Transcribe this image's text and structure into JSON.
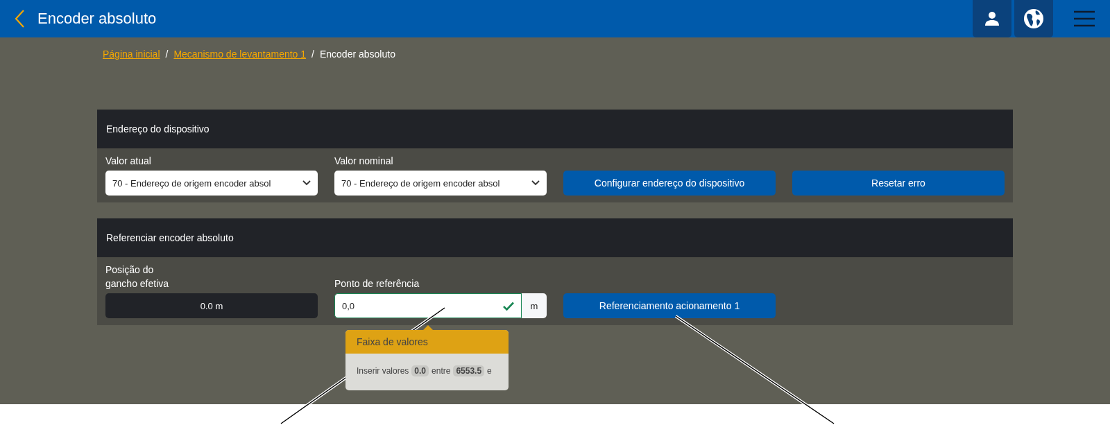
{
  "header": {
    "title": "Encoder absoluto"
  },
  "breadcrumb": [
    {
      "label": "Página inicial",
      "link": true
    },
    {
      "label": "Mecanismo de levantamento 1",
      "link": true
    },
    {
      "label": "Encoder absoluto",
      "link": false
    }
  ],
  "breadcrumb_separators": [
    "/",
    "/"
  ],
  "device_address": {
    "title": "Endereço do dispositivo",
    "current": {
      "label": "Valor atual",
      "value": "70 - Endereço de origem encoder absol"
    },
    "nominal": {
      "label": "Valor nominal",
      "value": "70 - Endereço de origem encoder absol"
    },
    "buttons": [
      "Configurar endereço do dispositivo",
      "Resetar erro"
    ]
  },
  "referencing": {
    "title": "Referenciar encoder absoluto",
    "position": {
      "label": "Posição do gancho efetiva",
      "value": "0.0 m"
    },
    "reference": {
      "label": "Ponto de referência",
      "value": "0,0",
      "unit": "m",
      "valid": true
    },
    "button": "Referenciamento acionamento 1",
    "tooltip": {
      "title": "Faixa de valores",
      "parts": [
        {
          "kind": "text",
          "text": "Inserir valores"
        },
        {
          "kind": "pill",
          "text": "0.0"
        },
        {
          "kind": "text",
          "text": "entre"
        },
        {
          "kind": "pill",
          "text": "6553.5"
        },
        {
          "kind": "text",
          "text": "e"
        }
      ]
    }
  }
}
